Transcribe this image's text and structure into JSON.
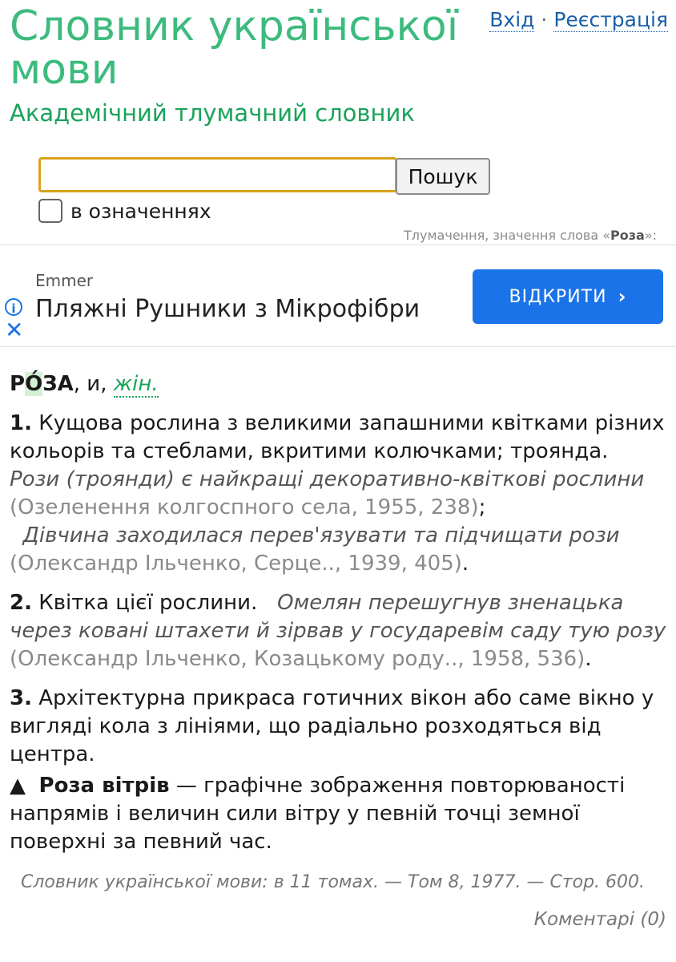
{
  "header": {
    "title": "Словник української мови",
    "subtitle": "Академічний тлумачний словник",
    "login": "Вхід",
    "separator": "·",
    "register": "Реєстрація"
  },
  "search": {
    "value": "",
    "button": "Пошук",
    "checkbox_label": "в означеннях",
    "checkbox_checked": false
  },
  "caption": {
    "prefix": "Тлумачення, значення слова «",
    "word": "Роза",
    "suffix": "»:"
  },
  "ad": {
    "advertiser": "Emmer",
    "headline": "Пляжні Рушники з Мікрофібри",
    "button": "ВІДКРИТИ",
    "button_color": "#1a73e8"
  },
  "entry": {
    "hw_a": "Р",
    "hw_accent": "О́",
    "hw_b": "ЗА",
    "forms": ", и, ",
    "gram": "жін.",
    "senses": [
      {
        "num": "1.",
        "def": " Кущова рослина з великими запашними квітками різних кольорів та стеблами, вкритими колючками; троянда.",
        "ex1": "Рози (троянди) є найкращі декоративно-квіткові рослини",
        "src1": "(Озеленення колгоспного села, 1955, 238)",
        "sep1": ";",
        "ex2": "Дівчина заходилася перев'язувати та підчищати рози",
        "src2": "(Олександр Ільченко, Серце.., 1939, 405)",
        "end": "."
      },
      {
        "num": "2.",
        "def": " Квітка цієї рослини.",
        "ex1": "Омелян перешугнув зненацька через ковані штахети й зірвав у государевім саду тую розу",
        "src1": "(Олександр Ільченко, Козацькому роду.., 1958, 536)",
        "end": "."
      },
      {
        "num": "3.",
        "def": " Архітектурна прикраса готичних вікон або саме вікно у вигляді кола з лініями, що радіально розходяться від центра."
      }
    ],
    "phrase": {
      "marker": "▲",
      "term": "Роза вітрів",
      "def": " — графічне зображення повторюваності напрямів і величин сили вітру у певній точці земної поверхні за певний час."
    }
  },
  "footer": {
    "source": "Словник української мови: в 11 томах. — Том 8, 1977. — Стор. 600.",
    "comments": "Коментарі (0)"
  }
}
